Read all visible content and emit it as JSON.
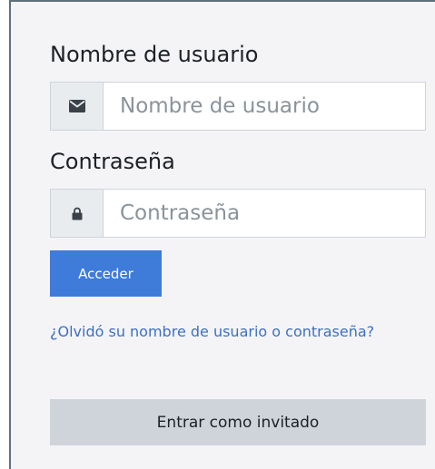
{
  "login": {
    "username": {
      "label": "Nombre de usuario",
      "placeholder": "Nombre de usuario",
      "value": "",
      "icon": "envelope-icon"
    },
    "password": {
      "label": "Contraseña",
      "placeholder": "Contraseña",
      "value": "",
      "icon": "lock-icon"
    },
    "submit_label": "Acceder",
    "forgot_link_text": "¿Olvidó su nombre de usuario o contraseña?",
    "guest_label": "Entrar como invitado"
  },
  "colors": {
    "primary": "#3f7bd9",
    "link": "#3d6fc4",
    "panel_background": "#f4f4f7",
    "addon_background": "#e9ecef",
    "guest_button": "#ced4da",
    "text": "#1d2125",
    "placeholder": "#8a939b"
  }
}
